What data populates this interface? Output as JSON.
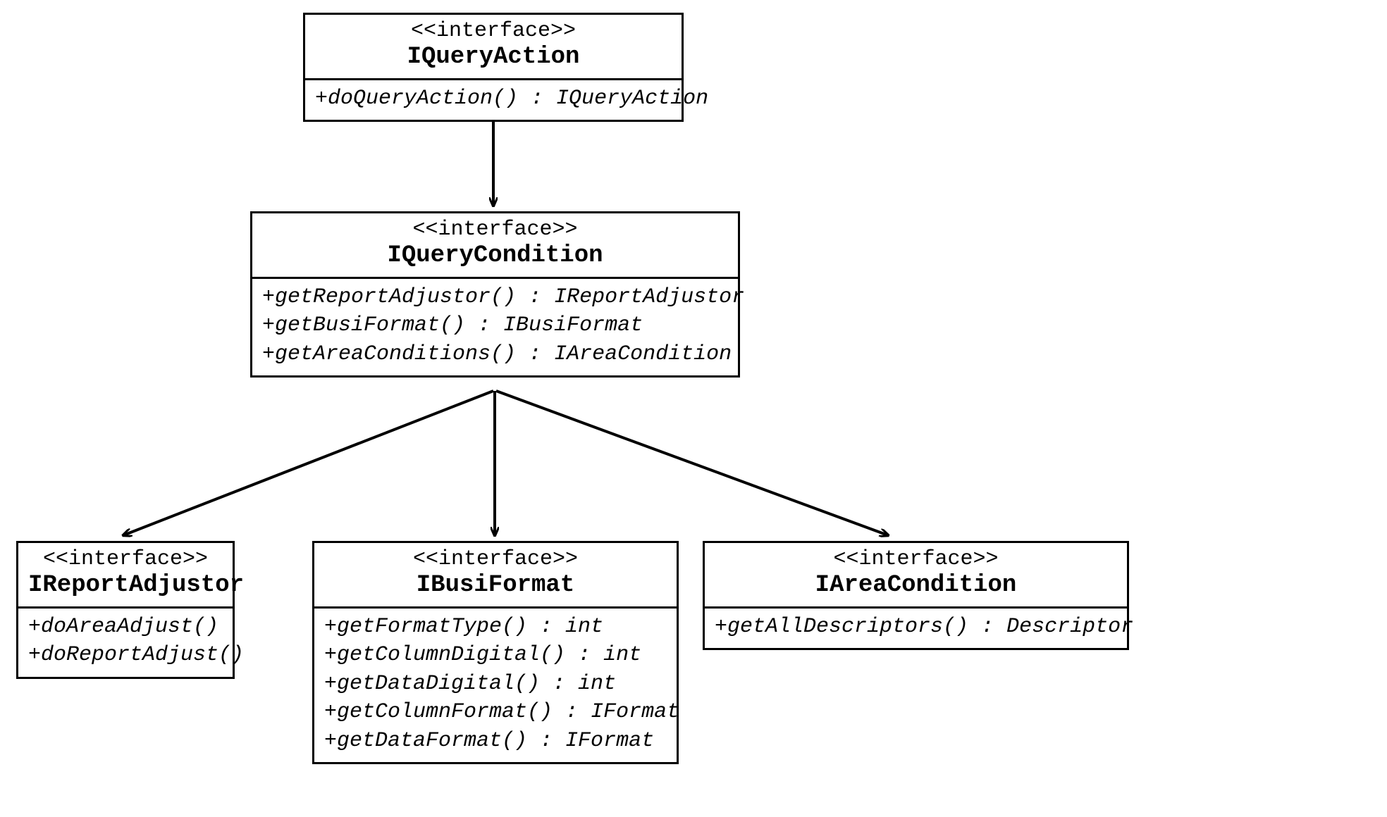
{
  "boxes": {
    "queryAction": {
      "stereotype": "<<interface>>",
      "name": "IQueryAction",
      "methods": [
        "+doQueryAction() : IQueryAction"
      ]
    },
    "queryCondition": {
      "stereotype": "<<interface>>",
      "name": "IQueryCondition",
      "methods": [
        "+getReportAdjustor() : IReportAdjustor",
        "+getBusiFormat() : IBusiFormat",
        "+getAreaConditions() : IAreaCondition"
      ]
    },
    "reportAdjustor": {
      "stereotype": "<<interface>>",
      "name": "IReportAdjustor",
      "methods": [
        "+doAreaAdjust()",
        "+doReportAdjust()"
      ]
    },
    "busiFormat": {
      "stereotype": "<<interface>>",
      "name": "IBusiFormat",
      "methods": [
        "+getFormatType() : int",
        "+getColumnDigital() : int",
        "+getDataDigital() : int",
        "+getColumnFormat() : IFormat",
        "+getDataFormat() : IFormat"
      ]
    },
    "areaCondition": {
      "stereotype": "<<interface>>",
      "name": "IAreaCondition",
      "methods": [
        "+getAllDescriptors() : Descriptor"
      ]
    }
  }
}
